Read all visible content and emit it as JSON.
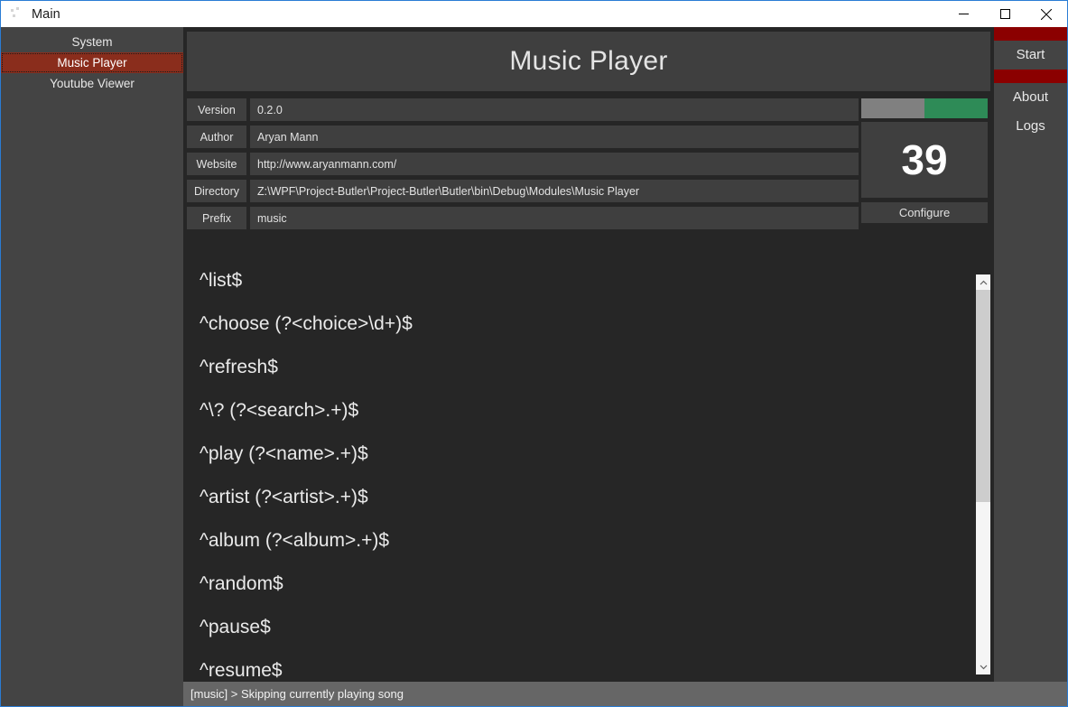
{
  "window": {
    "title": "Main",
    "icon": "app-icon",
    "controls": {
      "minimize": "minimize-icon",
      "maximize": "maximize-icon",
      "close": "close-icon"
    },
    "accent_border": "#2a7cd4"
  },
  "left_sidebar": {
    "items": [
      {
        "label": "System",
        "selected": false
      },
      {
        "label": "Music Player",
        "selected": true
      },
      {
        "label": "Youtube Viewer",
        "selected": false
      }
    ],
    "selected_color": "#8a2d1c",
    "background": "#444444"
  },
  "right_sidebar": {
    "items": [
      {
        "label": "Start"
      },
      {
        "label": "About"
      },
      {
        "label": "Logs"
      }
    ],
    "bar_color": "#8b0000",
    "background": "#444444"
  },
  "module": {
    "title": "Music Player",
    "fields": [
      {
        "label": "Version",
        "value": "0.2.0"
      },
      {
        "label": "Author",
        "value": "Aryan Mann"
      },
      {
        "label": "Website",
        "value": "http://www.aryanmann.com/"
      },
      {
        "label": "Directory",
        "value": "Z:\\WPF\\Project-Butler\\Project-Butler\\Butler\\bin\\Debug\\Modules\\Music Player"
      },
      {
        "label": "Prefix",
        "value": "music"
      }
    ]
  },
  "side_panel": {
    "toggle": {
      "name": "enabled-toggle",
      "state": "on",
      "off_color": "#808080",
      "on_color": "#2e8b57"
    },
    "count": "39",
    "configure_label": "Configure"
  },
  "commands": [
    "^list$",
    "^choose (?<choice>\\d+)$",
    "^refresh$",
    "^\\? (?<search>.+)$",
    "^play (?<name>.+)$",
    "^artist (?<artist>.+)$",
    "^album (?<album>.+)$",
    "^random$",
    "^pause$",
    "^resume$"
  ],
  "scrollbar": {
    "up_arrow": "chevron-up-icon",
    "down_arrow": "chevron-down-icon",
    "thumb_position": "top"
  },
  "status": {
    "text": "[music] > Skipping currently playing song"
  }
}
